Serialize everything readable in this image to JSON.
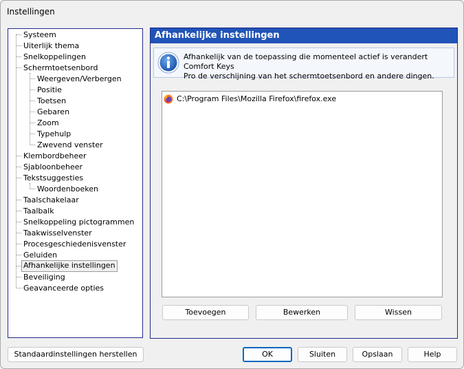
{
  "window": {
    "title": "Instellingen"
  },
  "tree": {
    "items": [
      "Systeem",
      "Uiterlijk thema",
      "Snelkoppelingen",
      "Schermtoetsenbord",
      "Weergeven/Verbergen",
      "Positie",
      "Toetsen",
      "Gebaren",
      "Zoom",
      "Typehulp",
      "Zwevend venster",
      "Klembordbeheer",
      "Sjabloonbeheer",
      "Tekstsuggesties",
      "Woordenboeken",
      "Taalschakelaar",
      "Taalbalk",
      "Snelkoppeling pictogrammen",
      "Taakwisselvenster",
      "Procesgeschiedenisvenster",
      "Geluiden",
      "Afhankelijke instellingen",
      "Beveiliging",
      "Geavanceerde opties"
    ],
    "selected": "Afhankelijke instellingen"
  },
  "panel": {
    "title": "Afhankelijke instellingen",
    "info_line1": "Afhankelijk van de toepassing die momenteel actief is verandert Comfort Keys",
    "info_line2": "Pro de verschijning van het schermtoetsenbord en andere dingen.",
    "info_icon": "info-icon",
    "list": [
      {
        "label": "C:\\Program Files\\Mozilla Firefox\\firefox.exe",
        "icon": "firefox-icon"
      }
    ],
    "buttons": {
      "add": "Toevoegen",
      "edit": "Bewerken",
      "delete": "Wissen"
    }
  },
  "footer": {
    "reset": "Standaardinstellingen herstellen",
    "ok": "OK",
    "close": "Sluiten",
    "save": "Opslaan",
    "help": "Help"
  },
  "colors": {
    "accent": "#2154b8",
    "default_button_border": "#0067c0"
  }
}
